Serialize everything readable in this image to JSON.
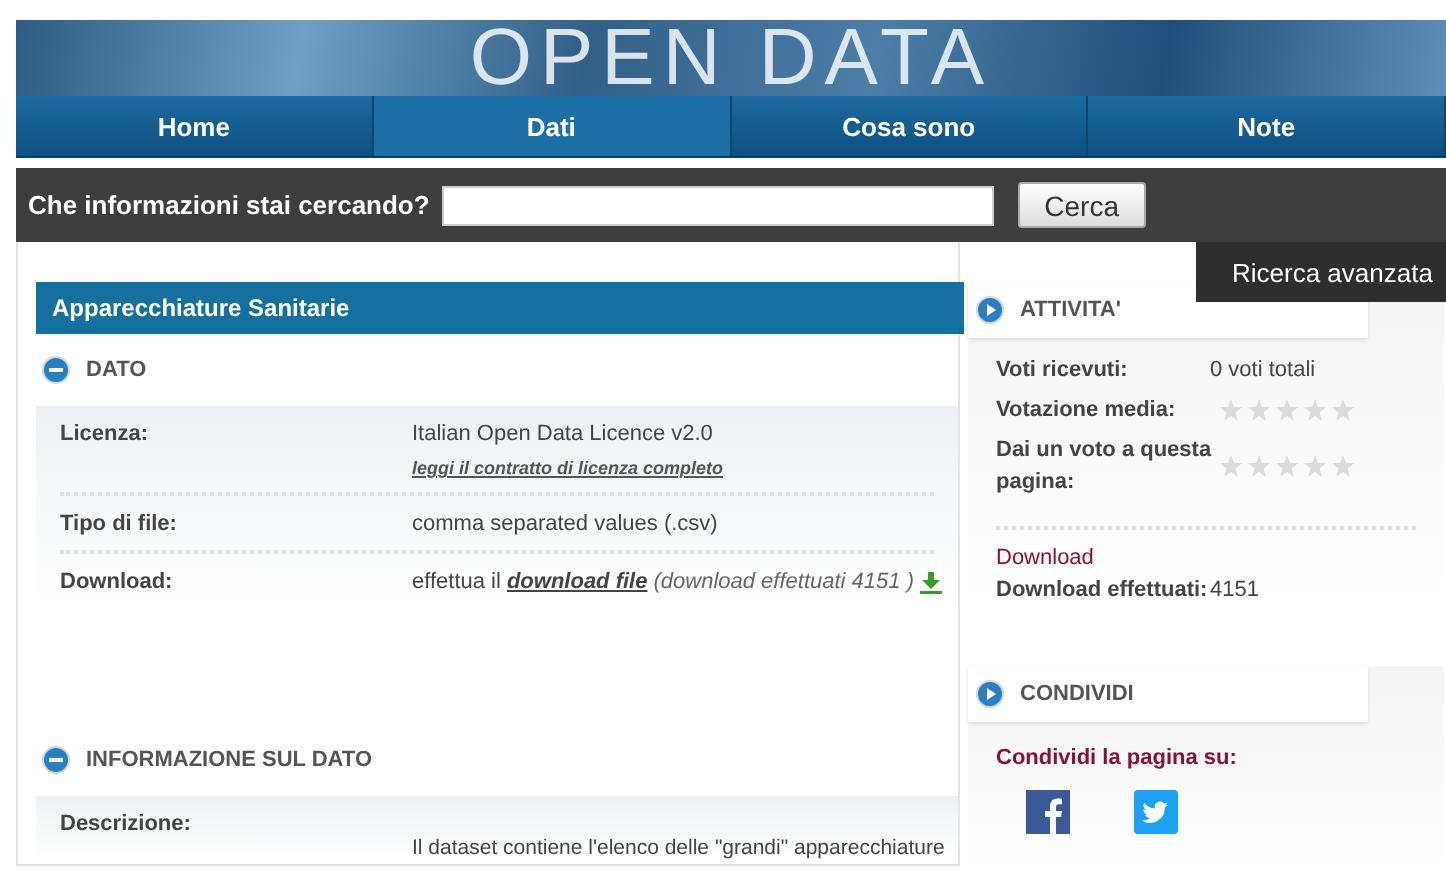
{
  "banner": {
    "logo": "OPEN DATA"
  },
  "nav": [
    {
      "label": "Home",
      "selected": false
    },
    {
      "label": "Dati",
      "selected": true
    },
    {
      "label": "Cosa sono",
      "selected": false
    },
    {
      "label": "Note",
      "selected": false
    }
  ],
  "search": {
    "label": "Che informazioni stai cercando?",
    "button": "Cerca",
    "tooltip": "Ricerca avanzata"
  },
  "dataset": {
    "title": "Apparecchiature Sanitarie",
    "sections": [
      {
        "heading": "DATO",
        "expanded": true,
        "rows": [
          {
            "label": "Licenza:",
            "value": "Italian Open Data Licence v2.0",
            "link": "leggi il contratto di licenza completo"
          },
          {
            "label": "Tipo di file:",
            "value": "comma separated values (.csv)"
          },
          {
            "label": "Download:",
            "prefix": "effettua il",
            "link": "download file",
            "note": "(download effettuati 4151 )",
            "download_icon": true
          }
        ]
      },
      {
        "heading": "INFORMAZIONE SUL DATO",
        "expanded": true,
        "rows": [
          {
            "label": "Descrizione:",
            "value": "Il dataset contiene l'elenco delle \"grandi\" apparecchiature"
          }
        ]
      }
    ]
  },
  "sidebar": {
    "activity": {
      "heading": "ATTIVITA'",
      "expanded": false,
      "rows": [
        {
          "label": "Voti ricevuti:",
          "value": "0 voti totali"
        },
        {
          "label": "Votazione media:",
          "stars": 0
        },
        {
          "label": "Dai un voto a questa pagina:",
          "stars": 0
        }
      ],
      "download_title": "Download",
      "download_label": "Download effettuati:",
      "download_count": "4151"
    },
    "share": {
      "heading": "CONDIVIDI",
      "expanded": false,
      "label": "Condividi la pagina su:"
    }
  }
}
